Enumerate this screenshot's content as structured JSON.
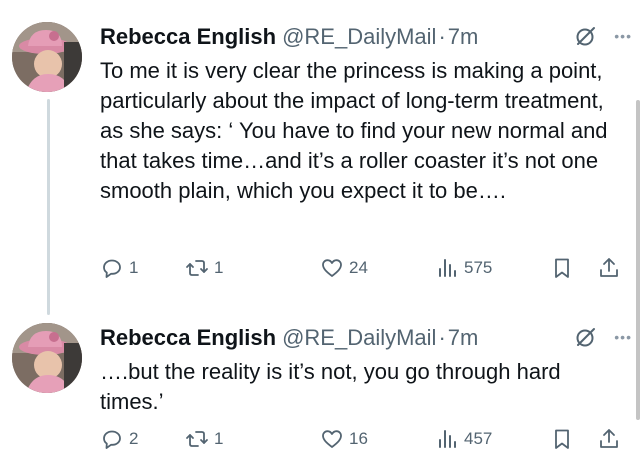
{
  "tweets": [
    {
      "author": {
        "name": "Rebecca English",
        "handle": "@RE_DailyMail",
        "time": "7m"
      },
      "text": "To me it is very clear the princess is making a point, particularly about the impact of long-term treatment, as she says: ‘ You have to find your new normal and that takes time…and it’s a roller coaster it’s not one smooth plain, which you expect it to be….",
      "actions": {
        "replies": "1",
        "reposts": "1",
        "likes": "24",
        "views": "575"
      },
      "icons": [
        "grok-icon",
        "more-icon",
        "reply-icon",
        "repost-icon",
        "like-icon",
        "views-icon",
        "bookmark-icon",
        "share-icon"
      ]
    },
    {
      "author": {
        "name": "Rebecca English",
        "handle": "@RE_DailyMail",
        "time": "7m"
      },
      "text": "….but the reality is it’s not, you go through hard times.’",
      "actions": {
        "replies": "2",
        "reposts": "1",
        "likes": "16",
        "views": "457"
      },
      "icons": [
        "grok-icon",
        "more-icon",
        "reply-icon",
        "repost-icon",
        "like-icon",
        "views-icon",
        "bookmark-icon",
        "share-icon"
      ]
    }
  ],
  "dot": "·",
  "more_glyph": "•••",
  "colors": {
    "text": "#0f1419",
    "secondary": "#536471",
    "thread_line": "#cfd9de"
  }
}
